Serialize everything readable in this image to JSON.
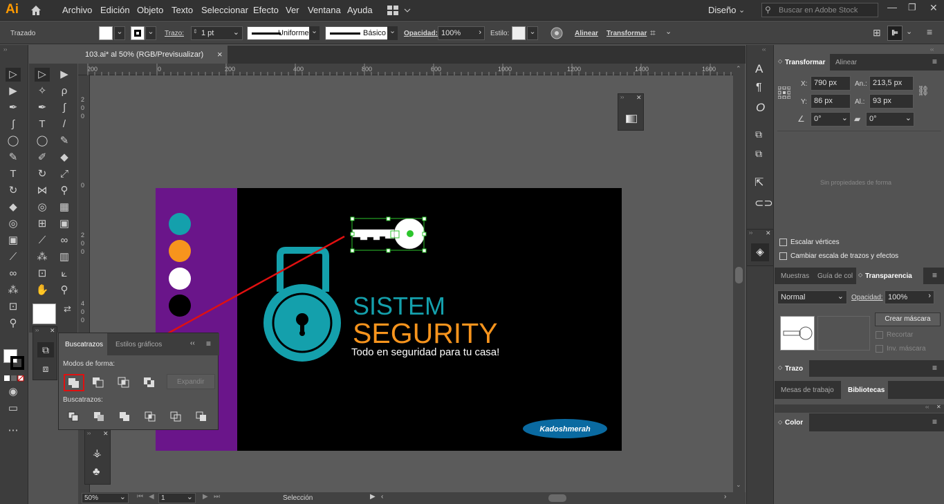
{
  "app": {
    "logo": "Ai",
    "workspace": "Diseño",
    "stock_search_placeholder": "Buscar en Adobe Stock"
  },
  "menu": [
    "Archivo",
    "Edición",
    "Objeto",
    "Texto",
    "Seleccionar",
    "Efecto",
    "Ver",
    "Ventana",
    "Ayuda"
  ],
  "control": {
    "mode": "Trazado",
    "stroke_label": "Trazo:",
    "stroke_value": "1 pt",
    "profile": "Uniforme",
    "brush": "Básico",
    "opacity_label": "Opacidad:",
    "opacity_value": "100%",
    "style_label": "Estilo:",
    "align": "Alinear",
    "transform": "Transformar"
  },
  "doc_tab": {
    "title": "103.ai* al 50% (RGB/Previsualizar)",
    "close": "×"
  },
  "ruler": {
    "h": [
      "200",
      "0",
      "200",
      "400",
      "600",
      "800",
      "1000",
      "1200",
      "1400",
      "1600"
    ],
    "v": [
      "2",
      "0",
      "0",
      "0",
      "2",
      "0",
      "0",
      "4",
      "0",
      "0"
    ]
  },
  "pathfinder": {
    "tab1": "Buscatrazos",
    "tab2": "Estilos gráficos",
    "shape_modes": "Modos de forma:",
    "expand": "Expandir",
    "pathfinders": "Buscatrazos:"
  },
  "artboard": {
    "title1": "SISTEM",
    "title2": "SEGURITY",
    "tagline": "Todo en seguridad para tu casa!",
    "badge": "Kadoshmerah",
    "colors": {
      "purple": "#6a158a",
      "teal": "#14a0ac",
      "orange": "#f7941d",
      "white": "#ffffff",
      "black": "#000000",
      "accent": "#0a6aa1"
    }
  },
  "transform": {
    "tab1": "Transformar",
    "tab2": "Alinear",
    "x_label": "X:",
    "x": "790 px",
    "w_label": "An.:",
    "w": "213,5 px",
    "y_label": "Y:",
    "y": "86 px",
    "h_label": "Al.:",
    "h": "93 px",
    "angle": "0°",
    "shear": "0°",
    "empty": "Sin propiedades de forma",
    "cb1": "Escalar vértices",
    "cb2": "Cambiar escala de trazos y efectos"
  },
  "transparency": {
    "tab1": "Muestras",
    "tab2": "Guía de col",
    "tab3": "Transparencia",
    "mode": "Normal",
    "opacity_label": "Opacidad:",
    "opacity": "100%",
    "mask_btn": "Crear máscara",
    "clip": "Recortar",
    "invert": "Inv. máscara"
  },
  "stroke_panel": {
    "title": "Trazo"
  },
  "libraries": {
    "tab1": "Mesas de trabajo",
    "tab2": "Bibliotecas"
  },
  "color_panel": {
    "title": "Color"
  },
  "status": {
    "zoom": "50%",
    "page": "1",
    "tool": "Selección"
  }
}
